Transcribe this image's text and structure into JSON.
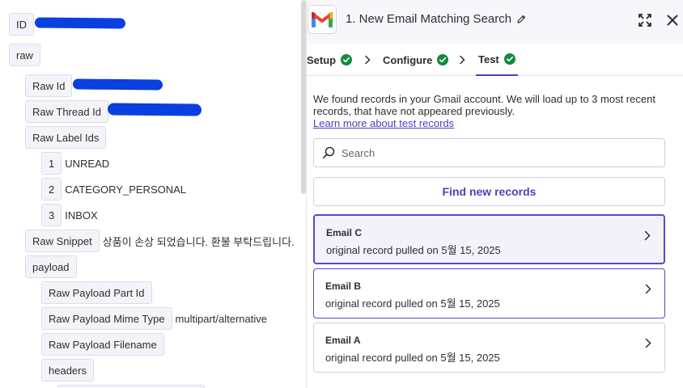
{
  "tree": {
    "id_key": "ID",
    "raw_key": "raw",
    "raw_id_key": "Raw Id",
    "raw_thread_id_key": "Raw Thread Id",
    "raw_label_ids_key": "Raw Label Ids",
    "labels": [
      {
        "index": "1",
        "value": "UNREAD"
      },
      {
        "index": "2",
        "value": "CATEGORY_PERSONAL"
      },
      {
        "index": "3",
        "value": "INBOX"
      }
    ],
    "raw_snippet_key": "Raw Snippet",
    "raw_snippet_value": "상품이 손상 되었습니다. 환불 부탁드립니다.",
    "payload_key": "payload",
    "raw_payload_part_id_key": "Raw Payload Part Id",
    "raw_payload_mime_type_key": "Raw Payload Mime Type",
    "raw_payload_mime_type_value": "multipart/alternative",
    "raw_payload_filename_key": "Raw Payload Filename",
    "headers_key": "headers"
  },
  "panel": {
    "step_title": "1. New Email Matching Search",
    "tabs": [
      {
        "label": "Setup"
      },
      {
        "label": "Configure"
      },
      {
        "label": "Test"
      }
    ],
    "intro_text": "We found records in your Gmail account. We will load up to 3 most recent records, that have not appeared previously.",
    "learn_more_link": "Learn more about test records",
    "search_placeholder": "Search",
    "find_button": "Find new records",
    "records": [
      {
        "name": "Email C",
        "subtitle": "original record pulled on 5월 15, 2025"
      },
      {
        "name": "Email B",
        "subtitle": "original record pulled on 5월 15, 2025"
      },
      {
        "name": "Email A",
        "subtitle": "original record pulled on 5월 15, 2025"
      }
    ]
  },
  "colors": {
    "accent": "#503ebd",
    "success": "#138a3f",
    "redaction": "#0a3fe0",
    "gmail_red": "#ea4335"
  }
}
